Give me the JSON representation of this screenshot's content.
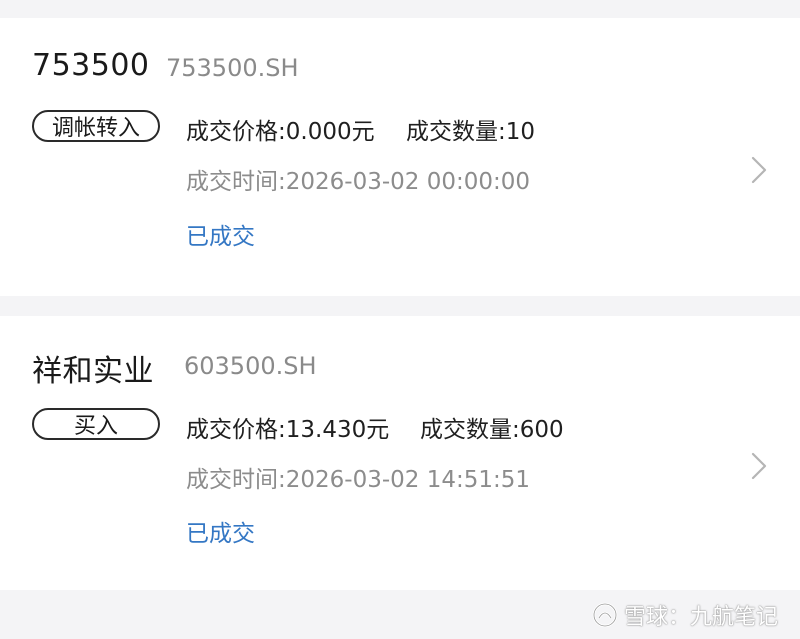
{
  "orders": [
    {
      "name": "753500",
      "code": "753500.SH",
      "type": "调帐转入",
      "price_text": "成交价格:0.000元",
      "qty_text": "成交数量:10",
      "time_text": "成交时间:2026-03-02 00:00:00",
      "status": "已成交"
    },
    {
      "name": "祥和实业",
      "code": "603500.SH",
      "type": "买入",
      "price_text": "成交价格:13.430元",
      "qty_text": "成交数量:600",
      "time_text": "成交时间:2026-03-02 14:51:51",
      "status": "已成交"
    }
  ],
  "watermark": {
    "text": "雪球：九航笔记"
  },
  "colors": {
    "status_blue": "#3477c4",
    "secondary_gray": "#8c8c8c",
    "background": "#f4f4f6"
  }
}
